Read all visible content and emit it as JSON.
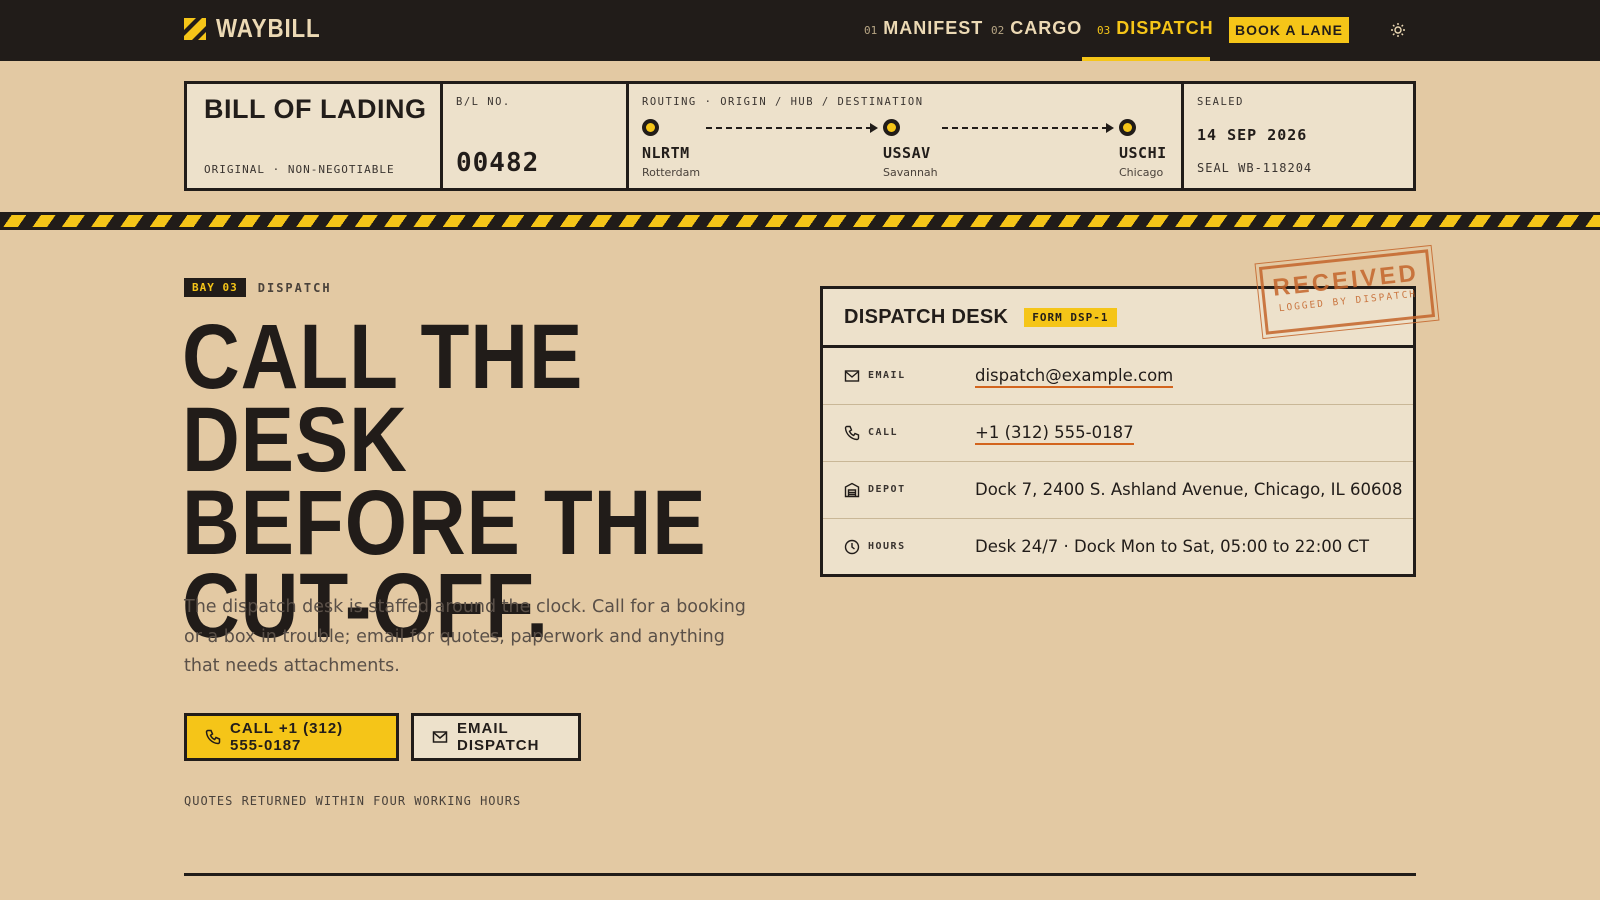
{
  "brand": {
    "name": "WAYBILL"
  },
  "nav": {
    "items": [
      {
        "num": "01",
        "label": "MANIFEST"
      },
      {
        "num": "02",
        "label": "CARGO"
      },
      {
        "num": "03",
        "label": "DISPATCH"
      }
    ],
    "active": "DISPATCH",
    "cta_label": "BOOK A LANE",
    "theme_icon": "sun-icon"
  },
  "bol": {
    "title": "BILL OF LADING",
    "subtitle": "ORIGINAL · NON-NEGOTIABLE",
    "number_label": "B/L NO.",
    "number": "00482",
    "routing_label": "ROUTING · ORIGIN / HUB / DESTINATION",
    "route": [
      {
        "code": "NLRTM",
        "city": "Rotterdam"
      },
      {
        "code": "USSAV",
        "city": "Savannah"
      },
      {
        "code": "USCHI",
        "city": "Chicago"
      }
    ],
    "sealed_label": "SEALED",
    "sealed_date": "14 SEP 2026",
    "seal_no": "SEAL WB-118204"
  },
  "hero": {
    "bay_badge": "BAY 03",
    "bay_label": "DISPATCH",
    "headline": "CALL THE DESK BEFORE THE CUT-OFF.",
    "lede": "The dispatch desk is staffed around the clock. Call for a booking or a box in trouble; email for quotes, paperwork and anything that needs attachments.",
    "call_button": "CALL +1 (312) 555-0187",
    "email_button": "EMAIL DISPATCH",
    "note": "QUOTES RETURNED WITHIN FOUR WORKING HOURS"
  },
  "desk": {
    "title": "DISPATCH DESK",
    "form_badge": "FORM DSP-1",
    "rows": [
      {
        "label": "EMAIL",
        "value": "dispatch@example.com",
        "icon": "mail-icon"
      },
      {
        "label": "CALL",
        "value": "+1 (312) 555-0187",
        "icon": "phone-icon"
      },
      {
        "label": "DEPOT",
        "value": "Dock 7, 2400 S. Ashland Avenue, Chicago, IL 60608",
        "icon": "warehouse-icon"
      },
      {
        "label": "HOURS",
        "value": "Desk 24/7 · Dock Mon to Sat, 05:00 to 22:00 CT",
        "icon": "clock-icon"
      }
    ],
    "stamp_main": "RECEIVED",
    "stamp_sub": "LOGGED BY DISPATCH"
  },
  "colors": {
    "background": "#e3c9a3",
    "ink": "#211c19",
    "accent_yellow": "#f5c518",
    "paper": "#ede1cb",
    "link_underline": "#d3641d",
    "stamp": "#c4652b"
  }
}
